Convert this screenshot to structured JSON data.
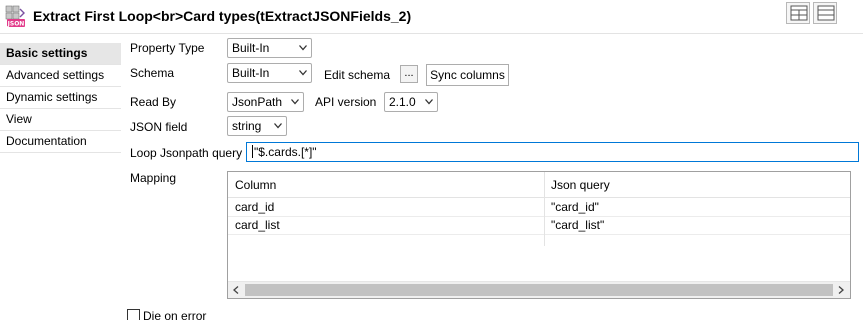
{
  "header": {
    "title": "Extract First Loop<br>Card types(tExtractJSONFields_2)",
    "component_icon": "json-component-icon",
    "view_buttons": [
      "table-layout-icon",
      "form-layout-icon"
    ]
  },
  "sidebar": {
    "tabs": [
      {
        "label": "Basic settings",
        "active": true
      },
      {
        "label": "Advanced settings",
        "active": false
      },
      {
        "label": "Dynamic settings",
        "active": false
      },
      {
        "label": "View",
        "active": false
      },
      {
        "label": "Documentation",
        "active": false
      }
    ]
  },
  "form": {
    "property_type": {
      "label": "Property Type",
      "value": "Built-In"
    },
    "schema": {
      "label": "Schema",
      "value": "Built-In",
      "edit_label": "Edit schema",
      "ellipsis": "...",
      "sync_label": "Sync columns"
    },
    "read_by": {
      "label": "Read By",
      "value": "JsonPath",
      "api_label": "API version",
      "api_value": "2.1.0"
    },
    "json_field": {
      "label": "JSON field",
      "value": "string"
    },
    "loop_query": {
      "label": "Loop Jsonpath query",
      "value": "\"$.cards.[*]\""
    },
    "mapping": {
      "label": "Mapping",
      "columns": [
        "Column",
        "Json query"
      ],
      "rows": [
        [
          "card_id",
          "\"card_id\""
        ],
        [
          "card_list",
          "\"card_list\""
        ]
      ]
    },
    "die_on_error": {
      "label": "Die on error",
      "checked": false
    }
  },
  "colors": {
    "focus_border": "#0078d7",
    "active_tab": "#e6e6e6",
    "scrollbar_thumb": "#c2c2c2"
  }
}
